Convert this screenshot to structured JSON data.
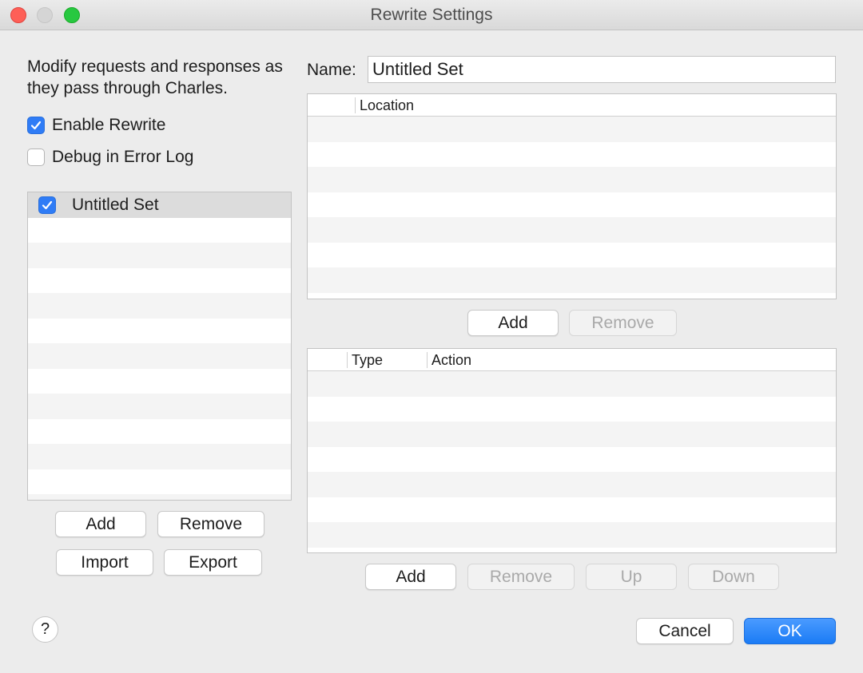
{
  "window": {
    "title": "Rewrite Settings"
  },
  "left": {
    "description": "Modify requests and responses as they pass through Charles.",
    "enable_rewrite": {
      "label": "Enable Rewrite",
      "checked": true
    },
    "debug_log": {
      "label": "Debug in Error Log",
      "checked": false
    },
    "sets": [
      {
        "label": "Untitled Set",
        "checked": true
      }
    ],
    "buttons": {
      "add": "Add",
      "remove": "Remove",
      "import": "Import",
      "export": "Export"
    }
  },
  "right": {
    "name_label": "Name:",
    "name_value": "Untitled Set",
    "locations_table": {
      "columns": [
        "",
        "Location"
      ],
      "rows": []
    },
    "locations_buttons": {
      "add": "Add",
      "remove": "Remove"
    },
    "rules_table": {
      "columns": [
        "",
        "Type",
        "Action"
      ],
      "rows": []
    },
    "rules_buttons": {
      "add": "Add",
      "remove": "Remove",
      "up": "Up",
      "down": "Down"
    }
  },
  "footer": {
    "help": "?",
    "cancel": "Cancel",
    "ok": "OK"
  },
  "colors": {
    "accent": "#2f7cf6",
    "close": "#fe5f57",
    "maximize": "#27c840"
  }
}
